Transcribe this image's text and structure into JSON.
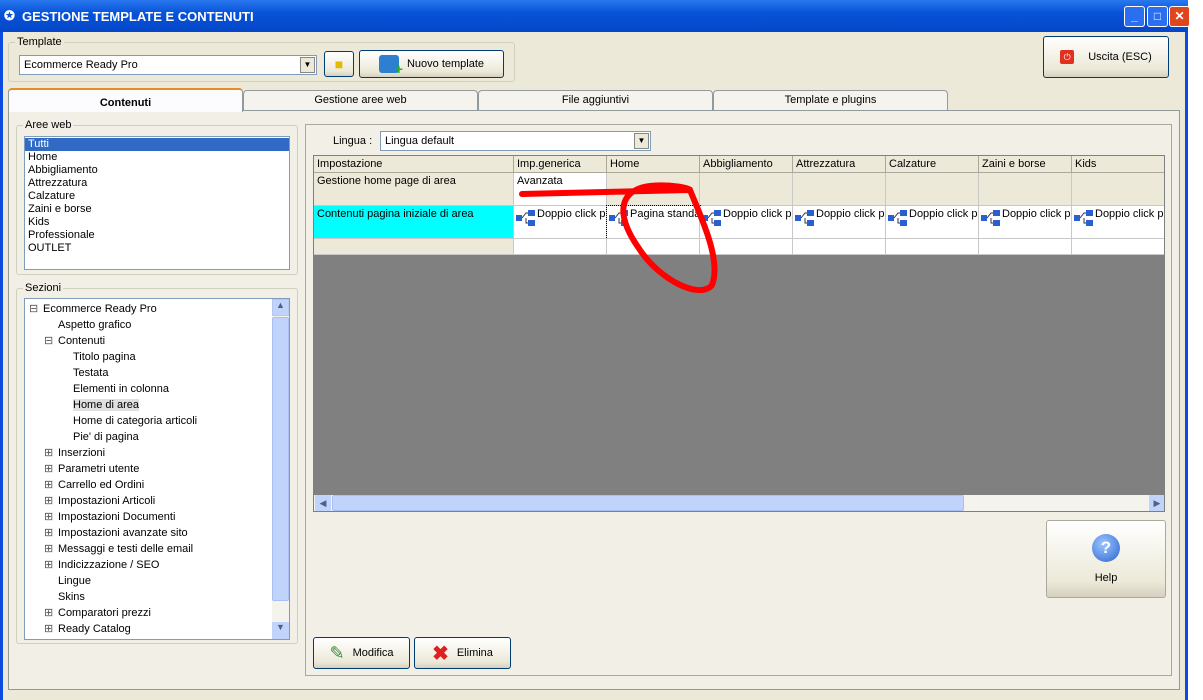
{
  "window": {
    "title": "GESTIONE TEMPLATE E CONTENUTI",
    "controls": [
      "_",
      "□",
      "✕"
    ]
  },
  "template": {
    "group_label": "Template",
    "selected": "Ecommerce Ready Pro",
    "new_button": "Nuovo template"
  },
  "exit_button": "Uscita (ESC)",
  "tabs": [
    "Contenuti",
    "Gestione aree web",
    "File aggiuntivi",
    "Template e plugins"
  ],
  "active_tab": 0,
  "aree_web": {
    "label": "Aree web",
    "items": [
      "Tutti",
      "Home",
      "Abbigliamento",
      "Attrezzatura",
      "Calzature",
      "Zaini e borse",
      "Kids",
      "Professionale",
      "OUTLET"
    ],
    "selected": 0
  },
  "sezioni": {
    "label": "Sezioni",
    "items": [
      {
        "label": "Ecommerce Ready Pro",
        "level": 0,
        "expander": "⊟"
      },
      {
        "label": "Aspetto grafico",
        "level": 1,
        "expander": ""
      },
      {
        "label": "Contenuti",
        "level": 1,
        "expander": "⊟"
      },
      {
        "label": "Titolo pagina",
        "level": 2,
        "expander": ""
      },
      {
        "label": "Testata",
        "level": 2,
        "expander": ""
      },
      {
        "label": "Elementi in colonna",
        "level": 2,
        "expander": ""
      },
      {
        "label": "Home di area",
        "level": 2,
        "expander": "",
        "selected": true
      },
      {
        "label": "Home di categoria articoli",
        "level": 2,
        "expander": ""
      },
      {
        "label": "Pie' di pagina",
        "level": 2,
        "expander": ""
      },
      {
        "label": "Inserzioni",
        "level": 1,
        "expander": "⊞"
      },
      {
        "label": "Parametri utente",
        "level": 1,
        "expander": "⊞"
      },
      {
        "label": "Carrello ed Ordini",
        "level": 1,
        "expander": "⊞"
      },
      {
        "label": "Impostazioni Articoli",
        "level": 1,
        "expander": "⊞"
      },
      {
        "label": "Impostazioni Documenti",
        "level": 1,
        "expander": "⊞"
      },
      {
        "label": "Impostazioni avanzate sito",
        "level": 1,
        "expander": "⊞"
      },
      {
        "label": "Messaggi e testi delle email",
        "level": 1,
        "expander": "⊞"
      },
      {
        "label": "Indicizzazione / SEO",
        "level": 1,
        "expander": "⊞"
      },
      {
        "label": "Lingue",
        "level": 1,
        "expander": ""
      },
      {
        "label": "Skins",
        "level": 1,
        "expander": ""
      },
      {
        "label": "Comparatori prezzi",
        "level": 1,
        "expander": "⊞"
      },
      {
        "label": "Ready Catalog",
        "level": 1,
        "expander": "⊞"
      }
    ]
  },
  "lingua": {
    "label": "Lingua :",
    "selected": "Lingua default"
  },
  "grid": {
    "columns": [
      "Impostazione",
      "Imp.generica",
      "Home",
      "Abbigliamento",
      "Attrezzatura",
      "Calzature",
      "Zaini e borse",
      "Kids"
    ],
    "rows": [
      {
        "label": "Gestione home page di area",
        "cells": [
          "Avanzata",
          "",
          "",
          "",
          "",
          "",
          ""
        ]
      },
      {
        "label": "Contenuti pagina iniziale di area",
        "cells": [
          "Doppio click per d...",
          "Pagina standard",
          "Doppio click per d...",
          "Doppio click per d...",
          "Doppio click per d...",
          "Doppio click per d...",
          "Doppio click per d..."
        ]
      }
    ]
  },
  "buttons": {
    "modifica": "Modifica",
    "elimina": "Elimina",
    "help": "Help"
  },
  "colors": {
    "selection": "#316ac5",
    "highlight_cell": "#00ffff",
    "annotation": "#ff0000"
  }
}
